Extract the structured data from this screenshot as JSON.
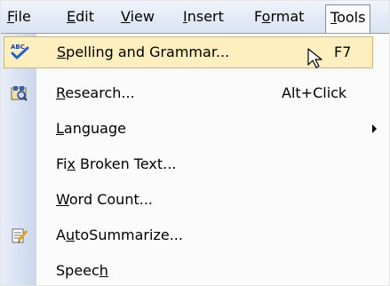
{
  "menubar": {
    "file": {
      "pre": "",
      "acc": "F",
      "post": "ile"
    },
    "edit": {
      "pre": "",
      "acc": "E",
      "post": "dit"
    },
    "view": {
      "pre": "",
      "acc": "V",
      "post": "iew"
    },
    "insert": {
      "pre": "",
      "acc": "I",
      "post": "nsert"
    },
    "format": {
      "pre": "F",
      "acc": "o",
      "post": "rmat"
    },
    "tools": {
      "pre": "",
      "acc": "T",
      "post": "ools"
    }
  },
  "tools_menu": {
    "items": [
      {
        "pre": "",
        "acc": "S",
        "post": "pelling and Grammar...",
        "shortcut": "F7",
        "icon": "spelling-icon",
        "highlighted": true
      },
      {
        "pre": "",
        "acc": "R",
        "post": "esearch...",
        "shortcut": "Alt+Click",
        "icon": "research-icon"
      },
      {
        "pre": "",
        "acc": "L",
        "post": "anguage",
        "shortcut": "",
        "submenu": true
      },
      {
        "pre": "Fi",
        "acc": "x",
        "post": " Broken Text...",
        "shortcut": ""
      },
      {
        "pre": "",
        "acc": "W",
        "post": "ord Count...",
        "shortcut": ""
      },
      {
        "pre": "A",
        "acc": "u",
        "post": "toSummarize...",
        "shortcut": "",
        "icon": "autosummarize-icon"
      },
      {
        "pre": "Speec",
        "acc": "h",
        "post": "",
        "shortcut": ""
      }
    ]
  },
  "colors": {
    "highlight_fill": "#ffeebe",
    "highlight_border": "#ccb57a",
    "gutter": "#c9d6ec"
  }
}
